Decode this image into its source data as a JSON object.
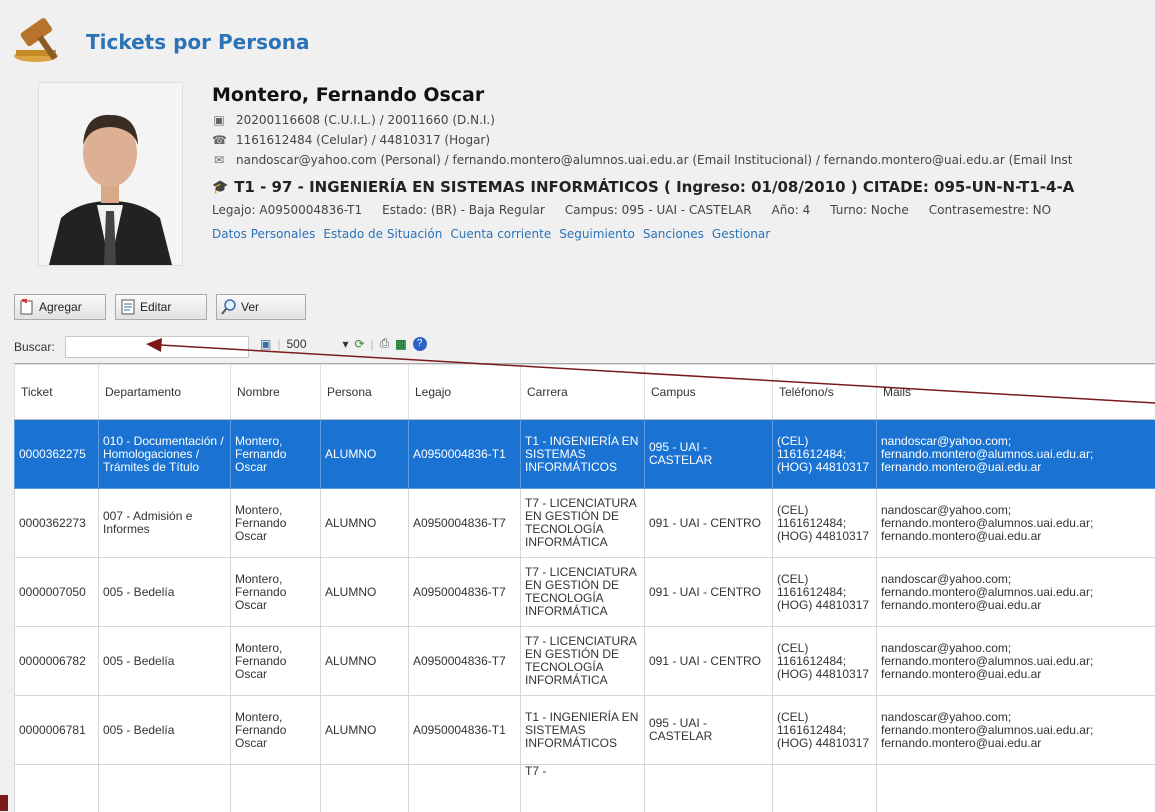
{
  "header": {
    "title": "Tickets por Persona"
  },
  "person": {
    "name": "Montero, Fernando Oscar",
    "ids": "20200116608 (C.U.I.L.) / 20011660 (D.N.I.)",
    "phones": "1161612484 (Celular) / 44810317 (Hogar)",
    "emails": "nandoscar@yahoo.com (Personal) / fernando.montero@alumnos.uai.edu.ar (Email Institucional) / fernando.montero@uai.edu.ar (Email Inst",
    "career": "T1 - 97 - INGENIERÍA EN SISTEMAS INFORMÁTICOS   ( Ingreso: 01/08/2010 ) CITADE: 095-UN-N-T1-4-A",
    "legajo": "Legajo: A0950004836-T1",
    "estado": "Estado: (BR) - Baja Regular",
    "campus": "Campus: 095 - UAI - CASTELAR",
    "anio": "Año: 4",
    "turno": "Turno: Noche",
    "contrasemestre": "Contrasemestre: NO",
    "links": [
      "Datos Personales",
      "Estado de Situación",
      "Cuenta corriente",
      "Seguimiento",
      "Sanciones",
      "Gestionar"
    ]
  },
  "toolbar": {
    "add": "Agregar",
    "edit": "Editar",
    "view": "Ver"
  },
  "search": {
    "label": "Buscar:",
    "value": ""
  },
  "pager": {
    "page_size": "500"
  },
  "table": {
    "columns": [
      "Ticket",
      "Departamento",
      "Nombre",
      "Persona",
      "Legajo",
      "Carrera",
      "Campus",
      "Teléfono/s",
      "Mails"
    ],
    "rows": [
      [
        "0000362275",
        "010 - Documentación / Homologaciones / Trámites de Título",
        "Montero, Fernando Oscar",
        "ALUMNO",
        "A0950004836-T1",
        "T1 - INGENIERÍA EN SISTEMAS INFORMÁTICOS",
        "095 - UAI - CASTELAR",
        "(CEL) 1161612484; (HOG) 44810317",
        "nandoscar@yahoo.com; fernando.montero@alumnos.uai.edu.ar; fernando.montero@uai.edu.ar"
      ],
      [
        "0000362273",
        "007 - Admisión e Informes",
        "Montero, Fernando Oscar",
        "ALUMNO",
        "A0950004836-T7",
        "T7 - LICENCIATURA EN GESTIÓN DE TECNOLOGÍA INFORMÁTICA",
        "091 - UAI - CENTRO",
        "(CEL) 1161612484; (HOG) 44810317",
        "nandoscar@yahoo.com; fernando.montero@alumnos.uai.edu.ar; fernando.montero@uai.edu.ar"
      ],
      [
        "0000007050",
        "005 - Bedelía",
        "Montero, Fernando Oscar",
        "ALUMNO",
        "A0950004836-T7",
        "T7 - LICENCIATURA EN GESTIÓN DE TECNOLOGÍA INFORMÁTICA",
        "091 - UAI - CENTRO",
        "(CEL) 1161612484; (HOG) 44810317",
        "nandoscar@yahoo.com; fernando.montero@alumnos.uai.edu.ar; fernando.montero@uai.edu.ar"
      ],
      [
        "0000006782",
        "005 - Bedelía",
        "Montero, Fernando Oscar",
        "ALUMNO",
        "A0950004836-T7",
        "T7 - LICENCIATURA EN GESTIÓN DE TECNOLOGÍA INFORMÁTICA",
        "091 - UAI - CENTRO",
        "(CEL) 1161612484; (HOG) 44810317",
        "nandoscar@yahoo.com; fernando.montero@alumnos.uai.edu.ar; fernando.montero@uai.edu.ar"
      ],
      [
        "0000006781",
        "005 - Bedelía",
        "Montero, Fernando Oscar",
        "ALUMNO",
        "A0950004836-T1",
        "T1 - INGENIERÍA EN SISTEMAS INFORMÁTICOS",
        "095 - UAI - CASTELAR",
        "(CEL) 1161612484; (HOG) 44810317",
        "nandoscar@yahoo.com; fernando.montero@alumnos.uai.edu.ar; fernando.montero@uai.edu.ar"
      ],
      [
        "",
        "",
        "",
        "",
        "",
        "T7 -",
        "",
        "",
        ""
      ]
    ]
  },
  "colors": {
    "title": "#2b73b7",
    "selected_row": "#1a73d2",
    "arrow": "#7a1a1a"
  },
  "icons": [
    "gavel-icon",
    "id-card-icon",
    "phone-icon",
    "mail-icon",
    "graduation-cap-icon",
    "add-icon",
    "edit-icon",
    "view-icon",
    "refresh-icon",
    "print-icon",
    "excel-icon",
    "help-icon"
  ]
}
